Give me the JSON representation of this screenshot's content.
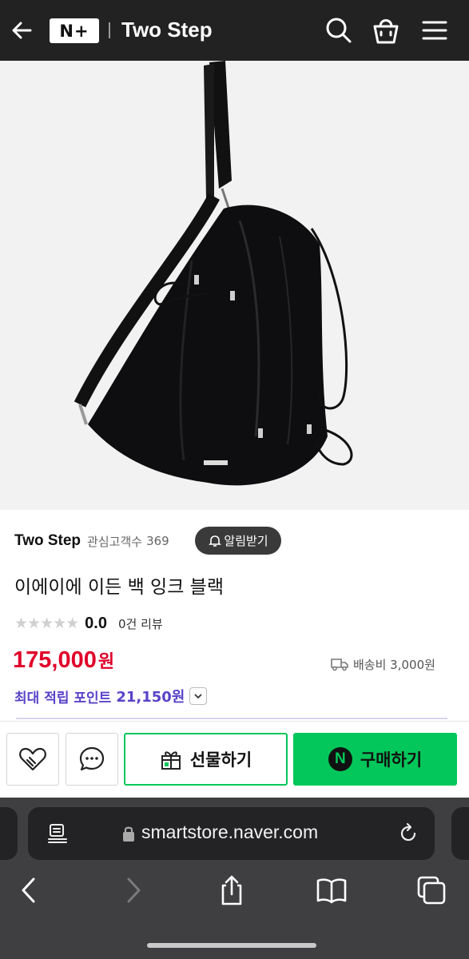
{
  "header": {
    "logo_text": "N+",
    "store_title": "Two Step",
    "icons": [
      "back-arrow-icon",
      "search-icon",
      "shopping-bag-icon",
      "menu-icon"
    ],
    "background": "#222222"
  },
  "product": {
    "store_name": "Two Step",
    "followers_label": "관심고객수",
    "followers_count": "369",
    "alarm_label": "알림받기",
    "title": "이에이에 이든 백 잉크 블랙",
    "rating_stars": "★★★★★",
    "rating_value": "0.0",
    "review_count": "0건 리뷰",
    "price": "175,000",
    "price_unit": "원",
    "shipping_label": "배송비 3,000원",
    "points_label": "최대 적립 포인트",
    "points_value": "21,150원",
    "price_color": "#e0002a",
    "points_color": "#5a43c8"
  },
  "actions": {
    "gift_label": "선물하기",
    "buy_label": "구매하기",
    "naver_badge": "N",
    "buy_color": "#03c75a"
  },
  "browser": {
    "url": "smartstore.naver.com",
    "icons": [
      "reader-icon",
      "lock-icon",
      "reload-icon",
      "nav-back-icon",
      "nav-forward-icon",
      "share-icon",
      "bookmarks-icon",
      "tabs-icon"
    ]
  }
}
